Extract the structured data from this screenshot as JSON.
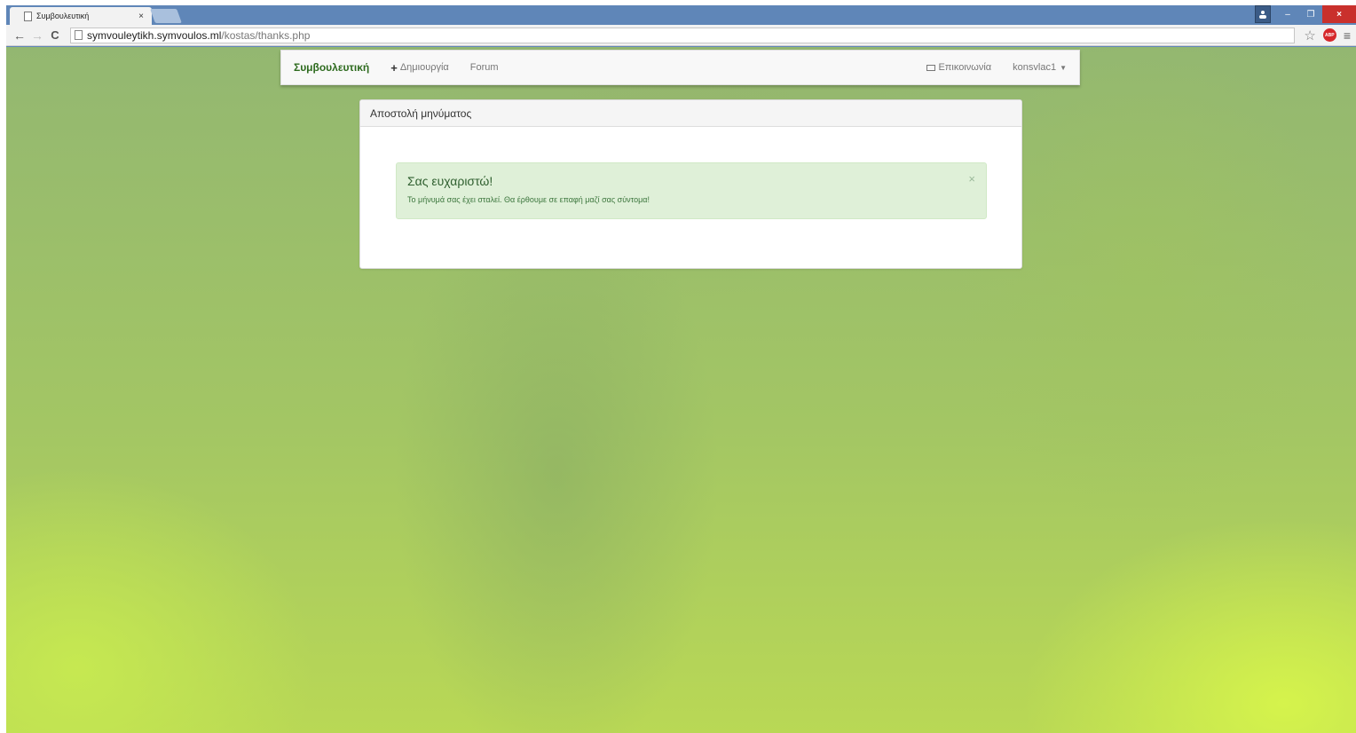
{
  "browser": {
    "tab_title": "Συμβουλευτική",
    "tab_close": "×",
    "url_host": "symvouleytikh.symvoulos.ml",
    "url_path": "/kostas/thanks.php",
    "abp_label": "ABP",
    "back": "←",
    "forward": "→",
    "reload": "C",
    "star": "☆",
    "menu": "≡",
    "minimize": "–",
    "restore": "❐",
    "close": "×"
  },
  "navbar": {
    "brand": "Συμβουλευτική",
    "create_plus": "+",
    "create_label": "Δημιουργία",
    "forum_label": "Forum",
    "contact_label": "Επικοινωνία",
    "user_label": "konsvlac1",
    "caret": "▼"
  },
  "panel": {
    "heading": "Αποστολή μηνύματος",
    "alert_title": "Σας ευχαριστώ!",
    "alert_text": "Το μήνυμά σας έχει σταλεί. Θα έρθουμε σε επαφή μαζί σας σύντομα!",
    "alert_close": "×"
  },
  "colors": {
    "brand": "#2e6b1f",
    "alert_bg": "#dff0d8",
    "alert_text": "#3c763d",
    "chrome_frame": "#5f86b8"
  }
}
